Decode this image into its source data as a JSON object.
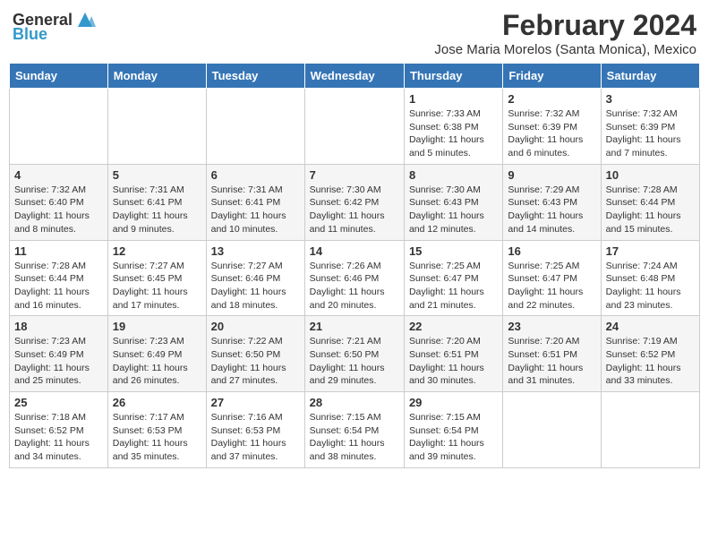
{
  "header": {
    "logo": {
      "text_general": "General",
      "text_blue": "Blue",
      "tagline": ""
    },
    "title": "February 2024",
    "subtitle": "Jose Maria Morelos (Santa Monica), Mexico"
  },
  "weekdays": [
    "Sunday",
    "Monday",
    "Tuesday",
    "Wednesday",
    "Thursday",
    "Friday",
    "Saturday"
  ],
  "weeks": [
    [
      {
        "day": "",
        "info": ""
      },
      {
        "day": "",
        "info": ""
      },
      {
        "day": "",
        "info": ""
      },
      {
        "day": "",
        "info": ""
      },
      {
        "day": "1",
        "info": "Sunrise: 7:33 AM\nSunset: 6:38 PM\nDaylight: 11 hours and 5 minutes."
      },
      {
        "day": "2",
        "info": "Sunrise: 7:32 AM\nSunset: 6:39 PM\nDaylight: 11 hours and 6 minutes."
      },
      {
        "day": "3",
        "info": "Sunrise: 7:32 AM\nSunset: 6:39 PM\nDaylight: 11 hours and 7 minutes."
      }
    ],
    [
      {
        "day": "4",
        "info": "Sunrise: 7:32 AM\nSunset: 6:40 PM\nDaylight: 11 hours and 8 minutes."
      },
      {
        "day": "5",
        "info": "Sunrise: 7:31 AM\nSunset: 6:41 PM\nDaylight: 11 hours and 9 minutes."
      },
      {
        "day": "6",
        "info": "Sunrise: 7:31 AM\nSunset: 6:41 PM\nDaylight: 11 hours and 10 minutes."
      },
      {
        "day": "7",
        "info": "Sunrise: 7:30 AM\nSunset: 6:42 PM\nDaylight: 11 hours and 11 minutes."
      },
      {
        "day": "8",
        "info": "Sunrise: 7:30 AM\nSunset: 6:43 PM\nDaylight: 11 hours and 12 minutes."
      },
      {
        "day": "9",
        "info": "Sunrise: 7:29 AM\nSunset: 6:43 PM\nDaylight: 11 hours and 14 minutes."
      },
      {
        "day": "10",
        "info": "Sunrise: 7:28 AM\nSunset: 6:44 PM\nDaylight: 11 hours and 15 minutes."
      }
    ],
    [
      {
        "day": "11",
        "info": "Sunrise: 7:28 AM\nSunset: 6:44 PM\nDaylight: 11 hours and 16 minutes."
      },
      {
        "day": "12",
        "info": "Sunrise: 7:27 AM\nSunset: 6:45 PM\nDaylight: 11 hours and 17 minutes."
      },
      {
        "day": "13",
        "info": "Sunrise: 7:27 AM\nSunset: 6:46 PM\nDaylight: 11 hours and 18 minutes."
      },
      {
        "day": "14",
        "info": "Sunrise: 7:26 AM\nSunset: 6:46 PM\nDaylight: 11 hours and 20 minutes."
      },
      {
        "day": "15",
        "info": "Sunrise: 7:25 AM\nSunset: 6:47 PM\nDaylight: 11 hours and 21 minutes."
      },
      {
        "day": "16",
        "info": "Sunrise: 7:25 AM\nSunset: 6:47 PM\nDaylight: 11 hours and 22 minutes."
      },
      {
        "day": "17",
        "info": "Sunrise: 7:24 AM\nSunset: 6:48 PM\nDaylight: 11 hours and 23 minutes."
      }
    ],
    [
      {
        "day": "18",
        "info": "Sunrise: 7:23 AM\nSunset: 6:49 PM\nDaylight: 11 hours and 25 minutes."
      },
      {
        "day": "19",
        "info": "Sunrise: 7:23 AM\nSunset: 6:49 PM\nDaylight: 11 hours and 26 minutes."
      },
      {
        "day": "20",
        "info": "Sunrise: 7:22 AM\nSunset: 6:50 PM\nDaylight: 11 hours and 27 minutes."
      },
      {
        "day": "21",
        "info": "Sunrise: 7:21 AM\nSunset: 6:50 PM\nDaylight: 11 hours and 29 minutes."
      },
      {
        "day": "22",
        "info": "Sunrise: 7:20 AM\nSunset: 6:51 PM\nDaylight: 11 hours and 30 minutes."
      },
      {
        "day": "23",
        "info": "Sunrise: 7:20 AM\nSunset: 6:51 PM\nDaylight: 11 hours and 31 minutes."
      },
      {
        "day": "24",
        "info": "Sunrise: 7:19 AM\nSunset: 6:52 PM\nDaylight: 11 hours and 33 minutes."
      }
    ],
    [
      {
        "day": "25",
        "info": "Sunrise: 7:18 AM\nSunset: 6:52 PM\nDaylight: 11 hours and 34 minutes."
      },
      {
        "day": "26",
        "info": "Sunrise: 7:17 AM\nSunset: 6:53 PM\nDaylight: 11 hours and 35 minutes."
      },
      {
        "day": "27",
        "info": "Sunrise: 7:16 AM\nSunset: 6:53 PM\nDaylight: 11 hours and 37 minutes."
      },
      {
        "day": "28",
        "info": "Sunrise: 7:15 AM\nSunset: 6:54 PM\nDaylight: 11 hours and 38 minutes."
      },
      {
        "day": "29",
        "info": "Sunrise: 7:15 AM\nSunset: 6:54 PM\nDaylight: 11 hours and 39 minutes."
      },
      {
        "day": "",
        "info": ""
      },
      {
        "day": "",
        "info": ""
      }
    ]
  ]
}
